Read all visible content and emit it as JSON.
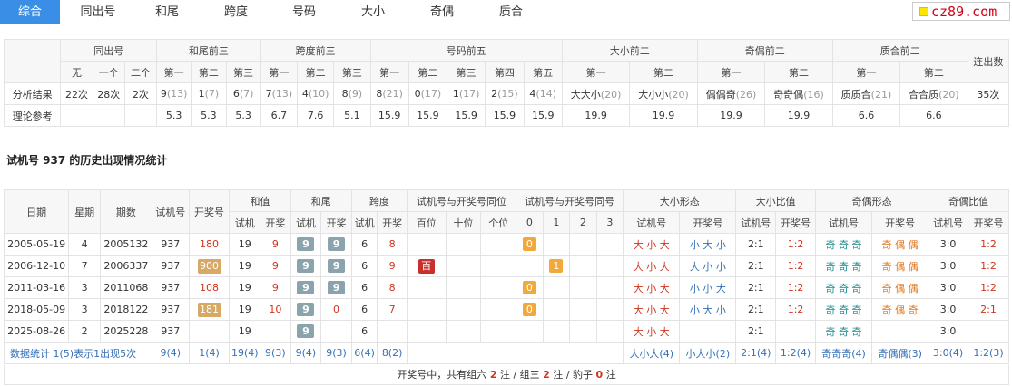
{
  "nav": {
    "tabs": [
      "综合",
      "同出号",
      "和尾",
      "跨度",
      "号码",
      "大小",
      "奇偶",
      "质合"
    ],
    "active": 0
  },
  "logo": {
    "text": "cz89.com"
  },
  "summary": {
    "groups": [
      "同出号",
      "和尾前三",
      "跨度前三",
      "号码前五",
      "大小前二",
      "奇偶前二",
      "质合前二",
      "连出数"
    ],
    "subheaders": [
      "无",
      "一个",
      "二个",
      "第一",
      "第二",
      "第三",
      "第一",
      "第二",
      "第三",
      "第一",
      "第二",
      "第三",
      "第四",
      "第五",
      "第一",
      "第二",
      "第一",
      "第二",
      "第一",
      "第二"
    ],
    "row_result_label": "分析结果",
    "row_result": [
      {
        "v": "22次"
      },
      {
        "v": "28次"
      },
      {
        "v": "2次"
      },
      {
        "v": "9",
        "c": "(13)"
      },
      {
        "v": "1",
        "c": "(7)"
      },
      {
        "v": "6",
        "c": "(7)"
      },
      {
        "v": "7",
        "c": "(13)"
      },
      {
        "v": "4",
        "c": "(10)"
      },
      {
        "v": "8",
        "c": "(9)"
      },
      {
        "v": "8",
        "c": "(21)"
      },
      {
        "v": "0",
        "c": "(17)"
      },
      {
        "v": "1",
        "c": "(17)"
      },
      {
        "v": "2",
        "c": "(15)"
      },
      {
        "v": "4",
        "c": "(14)"
      },
      {
        "v": "大大小",
        "c": "(20)"
      },
      {
        "v": "大小小",
        "c": "(20)"
      },
      {
        "v": "偶偶奇",
        "c": "(26)"
      },
      {
        "v": "奇奇偶",
        "c": "(16)"
      },
      {
        "v": "质质合",
        "c": "(21)"
      },
      {
        "v": "合合质",
        "c": "(20)"
      },
      {
        "v": "35次"
      }
    ],
    "row_theory_label": "理论参考",
    "row_theory": [
      "",
      "",
      "",
      "5.3",
      "5.3",
      "5.3",
      "6.7",
      "7.6",
      "5.1",
      "15.9",
      "15.9",
      "15.9",
      "15.9",
      "15.9",
      "19.9",
      "19.9",
      "19.9",
      "19.9",
      "6.6",
      "6.6",
      ""
    ]
  },
  "section_title": "试机号 937 的历史出现情况统计",
  "history": {
    "head1": {
      "date": "日期",
      "week": "星期",
      "issue": "期数",
      "trial": "试机号",
      "draw": "开奖号",
      "sum": "和值",
      "tail": "和尾",
      "span": "跨度",
      "same_pos": "试机号与开奖号同位",
      "same_num": "试机号与开奖号同号",
      "bs_form": "大小形态",
      "bs_ratio": "大小比值",
      "oe_form": "奇偶形态",
      "oe_ratio": "奇偶比值"
    },
    "head2": {
      "trial": "试机",
      "draw": "开奖",
      "pos": [
        "百位",
        "十位",
        "个位"
      ],
      "nums": [
        "0",
        "1",
        "2",
        "3"
      ],
      "trial_no": "试机号",
      "draw_no": "开奖号"
    },
    "rows": [
      {
        "date": "2005-05-19",
        "week": "4",
        "issue": "2005132",
        "trial": "937",
        "draw": "180",
        "draw_style": "red",
        "sum_t": "19",
        "sum_d": "9",
        "tail_t": "9",
        "tail_d": "9",
        "tail_d_box": true,
        "span_t": "6",
        "span_d": "8",
        "pos": [
          "",
          "",
          ""
        ],
        "nums": [
          "0",
          "",
          "",
          ""
        ],
        "bs_t": "大 小 大",
        "bs_d": "小 大 小",
        "bsr_t": "2:1",
        "bsr_d": "1:2",
        "oe_t": "奇 奇 奇",
        "oe_d": "奇 偶 偶",
        "oer_t": "3:0",
        "oer_d": "1:2"
      },
      {
        "date": "2006-12-10",
        "week": "7",
        "issue": "2006337",
        "trial": "937",
        "draw": "900",
        "draw_style": "box",
        "sum_t": "19",
        "sum_d": "9",
        "tail_t": "9",
        "tail_d": "9",
        "tail_d_box": true,
        "span_t": "6",
        "span_d": "9",
        "pos": [
          "百",
          "",
          ""
        ],
        "nums": [
          "",
          "1",
          "",
          ""
        ],
        "bs_t": "大 小 大",
        "bs_d": "大 小 小",
        "bsr_t": "2:1",
        "bsr_d": "1:2",
        "oe_t": "奇 奇 奇",
        "oe_d": "奇 偶 偶",
        "oer_t": "3:0",
        "oer_d": "1:2"
      },
      {
        "date": "2011-03-16",
        "week": "3",
        "issue": "2011068",
        "trial": "937",
        "draw": "108",
        "draw_style": "red",
        "sum_t": "19",
        "sum_d": "9",
        "tail_t": "9",
        "tail_d": "9",
        "tail_d_box": true,
        "span_t": "6",
        "span_d": "8",
        "pos": [
          "",
          "",
          ""
        ],
        "nums": [
          "0",
          "",
          "",
          ""
        ],
        "bs_t": "大 小 大",
        "bs_d": "小 小 大",
        "bsr_t": "2:1",
        "bsr_d": "1:2",
        "oe_t": "奇 奇 奇",
        "oe_d": "奇 偶 偶",
        "oer_t": "3:0",
        "oer_d": "1:2"
      },
      {
        "date": "2018-05-09",
        "week": "3",
        "issue": "2018122",
        "trial": "937",
        "draw": "181",
        "draw_style": "box",
        "sum_t": "19",
        "sum_d": "10",
        "tail_t": "9",
        "tail_d": "0",
        "tail_d_box": false,
        "span_t": "6",
        "span_d": "7",
        "pos": [
          "",
          "",
          ""
        ],
        "nums": [
          "0",
          "",
          "",
          ""
        ],
        "bs_t": "大 小 大",
        "bs_d": "小 大 小",
        "bsr_t": "2:1",
        "bsr_d": "1:2",
        "oe_t": "奇 奇 奇",
        "oe_d": "奇 偶 奇",
        "oer_t": "3:0",
        "oer_d": "2:1"
      },
      {
        "date": "2025-08-26",
        "week": "2",
        "issue": "2025228",
        "trial": "937",
        "draw": "",
        "draw_style": "red",
        "sum_t": "19",
        "sum_d": "",
        "tail_t": "9",
        "tail_d": "",
        "tail_d_box": false,
        "span_t": "6",
        "span_d": "",
        "pos": [
          "",
          "",
          ""
        ],
        "nums": [
          "",
          "",
          "",
          ""
        ],
        "bs_t": "大 小 大",
        "bs_d": "",
        "bsr_t": "2:1",
        "bsr_d": "",
        "oe_t": "奇 奇 奇",
        "oe_d": "",
        "oer_t": "3:0",
        "oer_d": ""
      }
    ],
    "stats": {
      "label": "数据统计",
      "desc": "1(5)表示1出现5次",
      "trial": "9(4)",
      "draw": "1(4)",
      "sum_t": "19(4)",
      "sum_d": "9(3)",
      "tail_t": "9(4)",
      "tail_d": "9(3)",
      "span_t": "6(4)",
      "span_d": "8(2)",
      "bs_t": "大小大(4)",
      "bs_d": "小大小(2)",
      "bsr_t": "2:1(4)",
      "bsr_d": "1:2(4)",
      "oe_t": "奇奇奇(4)",
      "oe_d": "奇偶偶(3)",
      "oer_t": "3:0(4)",
      "oer_d": "1:2(3)"
    },
    "footer": {
      "pre": "开奖号中，共有组六",
      "n1": "2",
      "mid1": "注 / 组三",
      "n2": "2",
      "mid2": "注 / 豹子",
      "n3": "0",
      "post": "注"
    }
  },
  "colors": {
    "accent": "#3a8ee6",
    "red": "#d0341f",
    "teal": "#1f8b8b",
    "orange": "#f2a93b",
    "tail_box": "#8aa3ac"
  }
}
